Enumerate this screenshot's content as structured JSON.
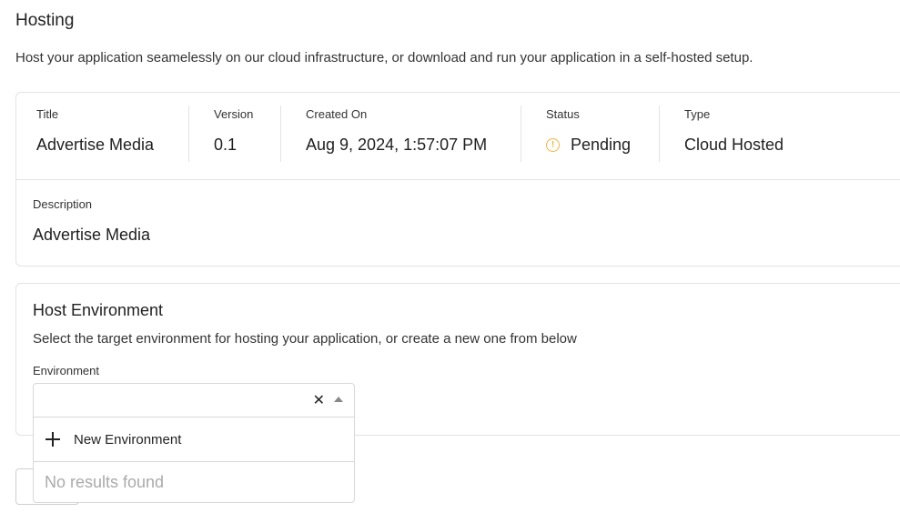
{
  "page": {
    "title": "Hosting",
    "subtitle": "Host your application seamelessly on our cloud infrastructure, or download and run your application in a self-hosted setup."
  },
  "info": {
    "title_label": "Title",
    "title_value": "Advertise Media",
    "version_label": "Version",
    "version_value": "0.1",
    "created_label": "Created On",
    "created_value": "Aug 9, 2024, 1:57:07 PM",
    "status_label": "Status",
    "status_value": "Pending",
    "status_icon": "warning-circle-icon",
    "status_color": "#f0b63c",
    "type_label": "Type",
    "type_value": "Cloud Hosted",
    "description_label": "Description",
    "description_value": "Advertise Media"
  },
  "environment": {
    "title": "Host Environment",
    "subtitle": "Select the target environment for hosting your application, or create a new one from below",
    "field_label": "Environment",
    "select_value": "",
    "clear_icon": "close-icon",
    "caret_icon": "caret-up-icon",
    "new_option_icon": "plus-icon",
    "new_option_label": "New Environment",
    "no_results_text": "No results found"
  }
}
